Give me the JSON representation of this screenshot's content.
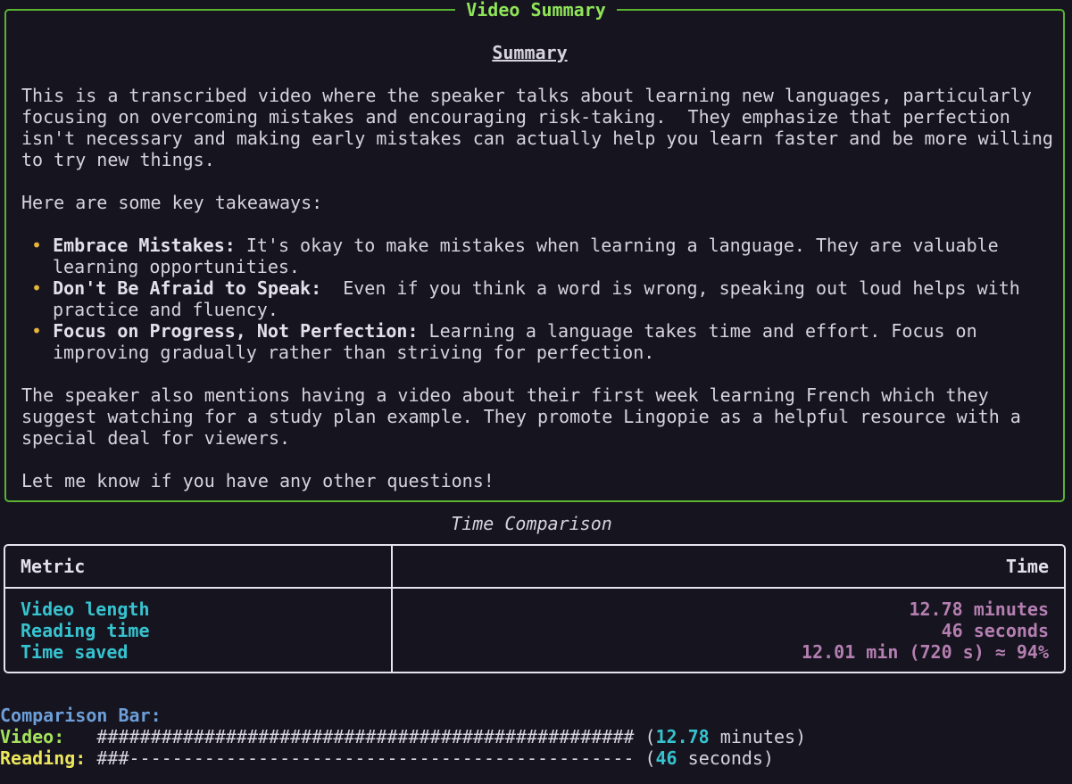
{
  "panel": {
    "title": "Video Summary",
    "heading": "Summary",
    "intro_lines": [
      "This is a transcribed video where the speaker talks about learning new languages, particularly",
      "focusing on overcoming mistakes and encouraging risk-taking.  They emphasize that perfection",
      "isn't necessary and making early mistakes can actually help you learn faster and be more willing",
      "to try new things."
    ],
    "takeaways_intro": "Here are some key takeaways:",
    "bullet_glyph": "•",
    "bullets": [
      {
        "bold": "Embrace Mistakes:",
        "text": " It's okay to make mistakes when learning a language. They are valuable",
        "cont": "learning opportunities."
      },
      {
        "bold": "Don't Be Afraid to Speak:",
        "text": "  Even if you think a word is wrong, speaking out loud helps with",
        "cont": "practice and fluency."
      },
      {
        "bold": "Focus on Progress, Not Perfection:",
        "text": " Learning a language takes time and effort. Focus on",
        "cont": "improving gradually rather than striving for perfection."
      }
    ],
    "outro_lines": [
      "The speaker also mentions having a video about their first week learning French which they",
      "suggest watching for a study plan example. They promote Lingopie as a helpful resource with a",
      "special deal for viewers."
    ],
    "closing": "Let me know if you have any other questions!"
  },
  "time_comparison": {
    "caption": "Time Comparison",
    "headers": {
      "metric": "Metric",
      "time": "Time"
    },
    "rows": [
      {
        "metric": "Video length",
        "time": "12.78 minutes"
      },
      {
        "metric": "Reading time",
        "time": "46 seconds"
      },
      {
        "metric": "Time saved",
        "time": "12.01 min (720 s) ≈ 94%"
      }
    ]
  },
  "comparison_bar": {
    "title": "Comparison Bar:",
    "video": {
      "label": "Video:",
      "pad": "   ",
      "bar": "################################################## (",
      "value": "12.78",
      "unit": " minutes)"
    },
    "reading": {
      "label": "Reading:",
      "pad": " ",
      "bar": "###----------------------------------------------- (",
      "value": "46",
      "unit": " seconds)"
    }
  },
  "colors": {
    "background": "#16141f",
    "panel_border": "#59b530",
    "panel_title": "#8fe457",
    "bullet": "#e6b53a",
    "metric": "#36c3cf",
    "value": "#b47fb0",
    "bar_title": "#6d9ed8",
    "video_label": "#a4e25b",
    "reading_label": "#ece65b"
  }
}
